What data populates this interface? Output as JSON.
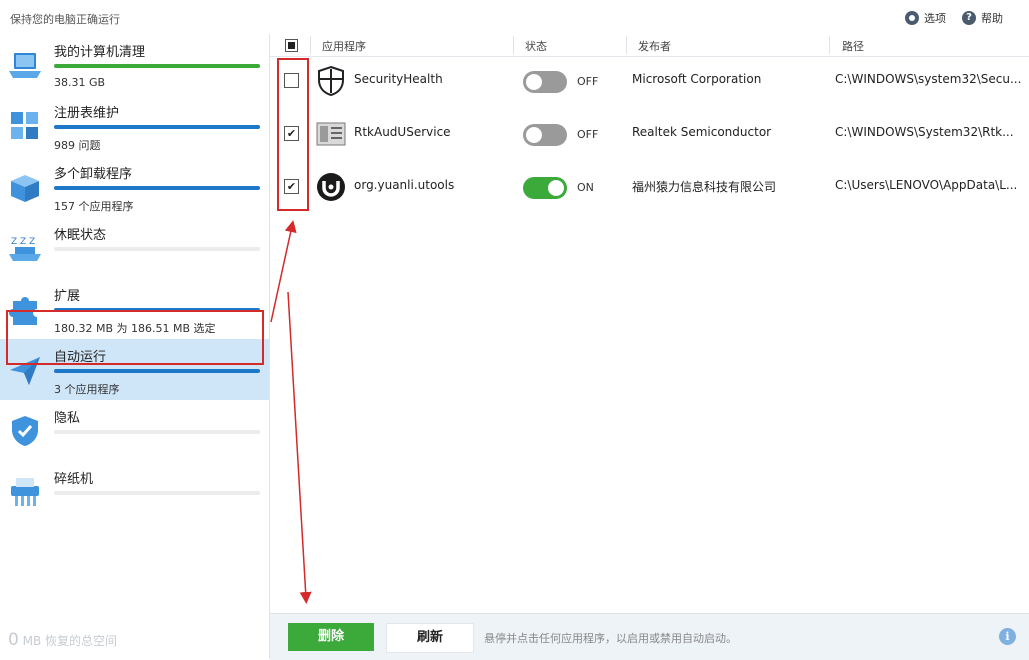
{
  "header": {
    "title": "保持您的电脑正确运行",
    "options_label": "选项",
    "help_label": "帮助",
    "help_glyph": "?"
  },
  "sidebar": {
    "items": [
      {
        "label": "我的计算机清理",
        "sub": "38.31 GB",
        "bar_fill": 1.0,
        "bar_color": "#3caa3a",
        "icon": "laptop-icon"
      },
      {
        "label": "注册表维护",
        "sub": "989 问题",
        "bar_fill": 1.0,
        "bar_color": "#1e78c8",
        "icon": "registry-cubes-icon"
      },
      {
        "label": "多个卸载程序",
        "sub": "157 个应用程序",
        "bar_fill": 1.0,
        "bar_color": "#1e78c8",
        "icon": "uninstall-box-icon"
      },
      {
        "label": "休眠状态",
        "sub": "",
        "bar_fill": 0.0,
        "bar_color": "#1e78c8",
        "icon": "sleep-zzz-icon"
      },
      {
        "label": "扩展",
        "sub": "180.32 MB 为 186.51 MB 选定",
        "bar_fill": 1.0,
        "bar_color": "#1e78c8",
        "icon": "puzzle-icon"
      },
      {
        "label": "自动运行",
        "sub": "3 个应用程序",
        "bar_fill": 1.0,
        "bar_color": "#1e78c8",
        "icon": "paper-plane-icon"
      },
      {
        "label": "隐私",
        "sub": "",
        "bar_fill": 0.0,
        "bar_color": "#1e78c8",
        "icon": "shield-icon"
      },
      {
        "label": "碎纸机",
        "sub": "",
        "bar_fill": 0.0,
        "bar_color": "#1e78c8",
        "icon": "shredder-icon"
      }
    ],
    "footer": {
      "amount": "0",
      "unit": "MB 恢复的总空间"
    }
  },
  "table": {
    "columns": [
      "应用程序",
      "状态",
      "发布者",
      "路径"
    ],
    "rows": [
      {
        "checked": false,
        "name": "SecurityHealth",
        "state": "OFF",
        "on": false,
        "publisher": "Microsoft Corporation",
        "path": "C:\\WINDOWS\\system32\\Secu...",
        "icon": "shield-outline-icon"
      },
      {
        "checked": true,
        "name": "RtkAudUService",
        "state": "OFF",
        "on": false,
        "publisher": "Realtek Semiconductor",
        "path": "C:\\WINDOWS\\System32\\Rtk...",
        "icon": "audio-service-icon"
      },
      {
        "checked": true,
        "name": "org.yuanli.utools",
        "state": "ON",
        "on": true,
        "publisher": "福州猿力信息科技有限公司",
        "path": "C:\\Users\\LENOVO\\AppData\\L...",
        "icon": "utools-icon"
      }
    ]
  },
  "bottom": {
    "delete_label": "删除",
    "refresh_label": "刷新",
    "hint": "悬停并点击任何应用程序，以启用或禁用自动启动。",
    "info_glyph": "i"
  },
  "colors": {
    "accent_green": "#3caa3a",
    "accent_blue": "#1e78c8",
    "annotation_red": "#d42a2a",
    "active_bg": "#cfe5f8"
  }
}
